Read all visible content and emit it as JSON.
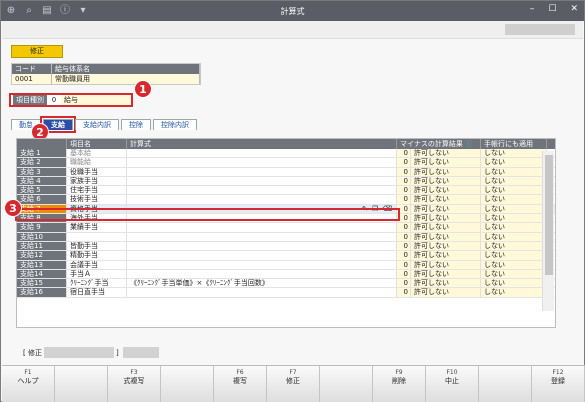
{
  "window": {
    "title": "計算式"
  },
  "fix_label": "修正",
  "code_table": {
    "headers": [
      "コード",
      "給与体系名"
    ],
    "row": [
      "0001",
      "常勤職員用"
    ]
  },
  "item_kind": {
    "label": "項目種別",
    "number": "0",
    "value": "給与"
  },
  "tabs": [
    "勤怠",
    "支給",
    "支給内訳",
    "控除",
    "控除内訳"
  ],
  "badges": [
    "1",
    "2",
    "3"
  ],
  "grid": {
    "headers": [
      "",
      "項目名",
      "計算式",
      "マイナスの計算結果",
      "手帳行にも適用"
    ],
    "rows": [
      {
        "no": "支給 1",
        "name": "基本給",
        "formula": "",
        "n": "0",
        "minus": "許可しない",
        "apply": "しない"
      },
      {
        "no": "支給 2",
        "name": "職能給",
        "formula": "",
        "n": "0",
        "minus": "許可しない",
        "apply": "しない"
      },
      {
        "no": "支給 3",
        "name": "役職手当",
        "formula": "",
        "n": "0",
        "minus": "許可しない",
        "apply": "しない"
      },
      {
        "no": "支給 4",
        "name": "家族手当",
        "formula": "",
        "n": "0",
        "minus": "許可しない",
        "apply": "しない"
      },
      {
        "no": "支給 5",
        "name": "住宅手当",
        "formula": "",
        "n": "0",
        "minus": "許可しない",
        "apply": "しない"
      },
      {
        "no": "支給 6",
        "name": "技術手当",
        "formula": "",
        "n": "0",
        "minus": "許可しない",
        "apply": "しない"
      },
      {
        "no": "支給 7",
        "name": "資格手当",
        "formula": "",
        "n": "0",
        "minus": "許可しない",
        "apply": "しない"
      },
      {
        "no": "支給 8",
        "name": "海外手当",
        "formula": "",
        "n": "0",
        "minus": "許可しない",
        "apply": "しない"
      },
      {
        "no": "支給 9",
        "name": "業績手当",
        "formula": "",
        "n": "0",
        "minus": "許可しない",
        "apply": "しない"
      },
      {
        "no": "支給10",
        "name": "",
        "formula": "",
        "n": "0",
        "minus": "許可しない",
        "apply": "しない"
      },
      {
        "no": "支給11",
        "name": "皆勤手当",
        "formula": "",
        "n": "0",
        "minus": "許可しない",
        "apply": "しない"
      },
      {
        "no": "支給12",
        "name": "精勤手当",
        "formula": "",
        "n": "0",
        "minus": "許可しない",
        "apply": "しない"
      },
      {
        "no": "支給13",
        "name": "会議手当",
        "formula": "",
        "n": "0",
        "minus": "許可しない",
        "apply": "しない"
      },
      {
        "no": "支給14",
        "name": "手当Ａ",
        "formula": "",
        "n": "0",
        "minus": "許可しない",
        "apply": "しない"
      },
      {
        "no": "支給15",
        "name": "ｸﾘｰﾆﾝｸﾞ手当",
        "formula": "《ｸﾘｰﾆﾝｸﾞ手当単価》×《ｸﾘｰﾆﾝｸﾞ手当回数》",
        "n": "0",
        "minus": "許可しない",
        "apply": "しない"
      },
      {
        "no": "支給16",
        "name": "宿日直手当",
        "formula": "",
        "n": "0",
        "minus": "許可しない",
        "apply": "しない"
      }
    ]
  },
  "status": {
    "open": "[ 修正",
    "close": "]"
  },
  "fkeys": [
    {
      "key": "F1",
      "label": "ヘルプ"
    },
    {
      "key": "",
      "label": ""
    },
    {
      "key": "F3",
      "label": "式複写"
    },
    {
      "key": "",
      "label": ""
    },
    {
      "key": "F6",
      "label": "複写"
    },
    {
      "key": "F7",
      "label": "修正"
    },
    {
      "key": "",
      "label": ""
    },
    {
      "key": "F9",
      "label": "削除"
    },
    {
      "key": "F10",
      "label": "中止"
    },
    {
      "key": "",
      "label": ""
    },
    {
      "key": "F12",
      "label": "登録"
    }
  ]
}
